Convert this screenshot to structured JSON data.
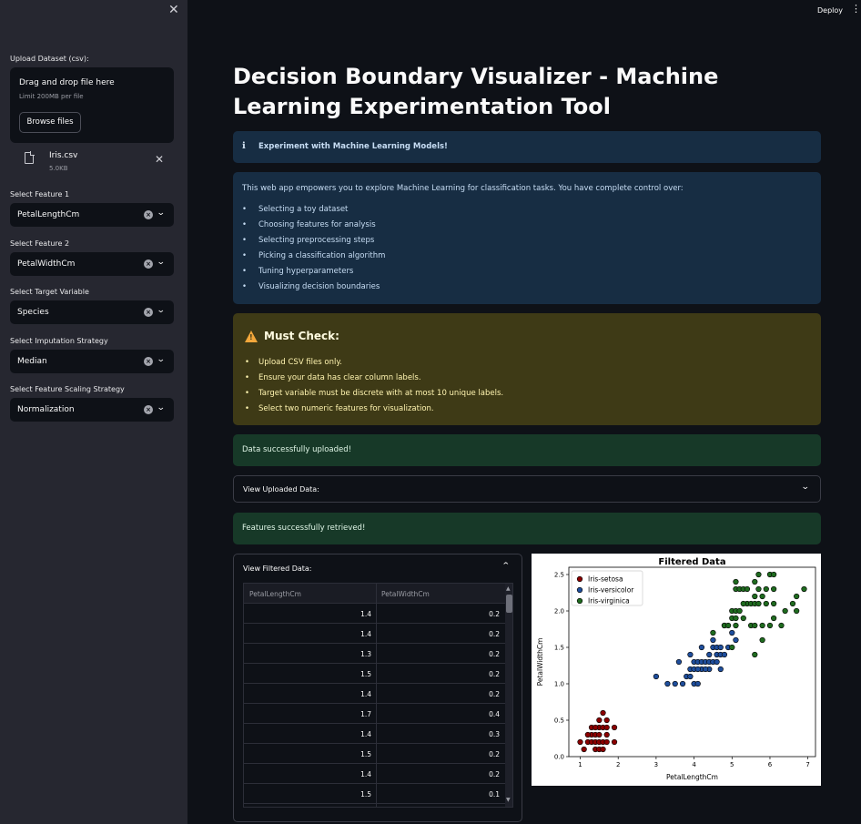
{
  "sidebar": {
    "close_label": "✕",
    "upload_label": "Upload Dataset (csv):",
    "dropzone_title": "Drag and drop file here",
    "dropzone_limit": "Limit 200MB per file",
    "browse_label": "Browse files",
    "file_name": "Iris.csv",
    "file_size": "5.0KB",
    "remove_label": "✕",
    "selects": [
      {
        "label": "Select Feature 1",
        "value": "PetalLengthCm"
      },
      {
        "label": "Select Feature 2",
        "value": "PetalWidthCm"
      },
      {
        "label": "Select Target Variable",
        "value": "Species"
      },
      {
        "label": "Select Imputation Strategy",
        "value": "Median"
      },
      {
        "label": "Select Feature Scaling Strategy",
        "value": "Normalization"
      }
    ]
  },
  "header": {
    "deploy_label": "Deploy",
    "menu_label": "⋮"
  },
  "main": {
    "title": "Decision Boundary Visualizer - Machine Learning Experimentation Tool",
    "info_title": "Experiment with Machine Learning Models!",
    "intro": "This web app empowers you to explore Machine Learning for classification tasks. You have complete control over:",
    "features": [
      "Selecting a toy dataset",
      "Choosing features for analysis",
      "Selecting preprocessing steps",
      "Picking a classification algorithm",
      "Tuning hyperparameters",
      "Visualizing decision boundaries"
    ],
    "warning_title": "Must Check:",
    "warnings": [
      "Upload CSV files only.",
      "Ensure your data has clear column labels.",
      "Target variable must be discrete with at most 10 unique labels.",
      "Select two numeric features for visualization."
    ],
    "success_upload": "Data successfully uploaded!",
    "expander_uploaded": "View Uploaded Data:",
    "success_features": "Features successfully retrieved!",
    "expander_filtered": "View Filtered Data:",
    "table": {
      "columns": [
        "PetalLengthCm",
        "PetalWidthCm"
      ],
      "rows": [
        [
          "1.4",
          "0.2"
        ],
        [
          "1.4",
          "0.2"
        ],
        [
          "1.3",
          "0.2"
        ],
        [
          "1.5",
          "0.2"
        ],
        [
          "1.4",
          "0.2"
        ],
        [
          "1.7",
          "0.4"
        ],
        [
          "1.4",
          "0.3"
        ],
        [
          "1.5",
          "0.2"
        ],
        [
          "1.4",
          "0.2"
        ],
        [
          "1.5",
          "0.1"
        ]
      ]
    }
  },
  "colors": {
    "setosa": "#8b0000",
    "versicolor": "#1f4e9c",
    "virginica": "#1f6b1f"
  },
  "chart_data": {
    "type": "scatter",
    "title": "Filtered Data",
    "xlabel": "PetalLengthCm",
    "ylabel": "PetalWidthCm",
    "xlim": [
      0.7,
      7.2
    ],
    "ylim": [
      0,
      2.6
    ],
    "xticks": [
      1,
      2,
      3,
      4,
      5,
      6,
      7
    ],
    "yticks": [
      0.0,
      0.5,
      1.0,
      1.5,
      2.0,
      2.5
    ],
    "legend_position": "top-left",
    "series": [
      {
        "name": "Iris-setosa",
        "color": "#8b0000",
        "points": [
          [
            1.0,
            0.2
          ],
          [
            1.1,
            0.1
          ],
          [
            1.2,
            0.2
          ],
          [
            1.3,
            0.2
          ],
          [
            1.3,
            0.3
          ],
          [
            1.3,
            0.4
          ],
          [
            1.4,
            0.1
          ],
          [
            1.4,
            0.2
          ],
          [
            1.4,
            0.3
          ],
          [
            1.5,
            0.1
          ],
          [
            1.5,
            0.2
          ],
          [
            1.5,
            0.3
          ],
          [
            1.5,
            0.4
          ],
          [
            1.6,
            0.2
          ],
          [
            1.6,
            0.4
          ],
          [
            1.6,
            0.6
          ],
          [
            1.7,
            0.2
          ],
          [
            1.7,
            0.3
          ],
          [
            1.7,
            0.4
          ],
          [
            1.7,
            0.5
          ],
          [
            1.9,
            0.2
          ],
          [
            1.9,
            0.4
          ],
          [
            1.6,
            0.1
          ],
          [
            1.2,
            0.3
          ],
          [
            1.4,
            0.4
          ],
          [
            1.5,
            0.5
          ]
        ]
      },
      {
        "name": "Iris-versicolor",
        "color": "#1f4e9c",
        "points": [
          [
            3.0,
            1.1
          ],
          [
            3.3,
            1.0
          ],
          [
            3.5,
            1.0
          ],
          [
            3.6,
            1.3
          ],
          [
            3.7,
            1.0
          ],
          [
            3.8,
            1.1
          ],
          [
            3.9,
            1.1
          ],
          [
            3.9,
            1.2
          ],
          [
            3.9,
            1.4
          ],
          [
            4.0,
            1.0
          ],
          [
            4.0,
            1.2
          ],
          [
            4.0,
            1.3
          ],
          [
            4.1,
            1.0
          ],
          [
            4.1,
            1.3
          ],
          [
            4.2,
            1.2
          ],
          [
            4.2,
            1.3
          ],
          [
            4.2,
            1.5
          ],
          [
            4.3,
            1.3
          ],
          [
            4.4,
            1.2
          ],
          [
            4.4,
            1.3
          ],
          [
            4.4,
            1.4
          ],
          [
            4.5,
            1.3
          ],
          [
            4.5,
            1.5
          ],
          [
            4.5,
            1.6
          ],
          [
            4.6,
            1.3
          ],
          [
            4.6,
            1.4
          ],
          [
            4.6,
            1.5
          ],
          [
            4.7,
            1.2
          ],
          [
            4.7,
            1.4
          ],
          [
            4.7,
            1.5
          ],
          [
            4.8,
            1.4
          ],
          [
            4.8,
            1.8
          ],
          [
            4.9,
            1.5
          ],
          [
            5.0,
            1.7
          ],
          [
            5.1,
            1.6
          ],
          [
            4.1,
            1.2
          ],
          [
            4.3,
            1.2
          ]
        ]
      },
      {
        "name": "Iris-virginica",
        "color": "#1f6b1f",
        "points": [
          [
            4.5,
            1.7
          ],
          [
            4.8,
            1.8
          ],
          [
            4.9,
            1.8
          ],
          [
            5.0,
            1.5
          ],
          [
            5.0,
            1.9
          ],
          [
            5.0,
            2.0
          ],
          [
            5.1,
            1.8
          ],
          [
            5.1,
            1.9
          ],
          [
            5.1,
            2.0
          ],
          [
            5.1,
            2.3
          ],
          [
            5.1,
            2.4
          ],
          [
            5.2,
            2.0
          ],
          [
            5.2,
            2.3
          ],
          [
            5.3,
            1.9
          ],
          [
            5.3,
            2.3
          ],
          [
            5.4,
            2.1
          ],
          [
            5.4,
            2.3
          ],
          [
            5.5,
            1.8
          ],
          [
            5.5,
            2.1
          ],
          [
            5.6,
            1.4
          ],
          [
            5.6,
            1.8
          ],
          [
            5.6,
            2.1
          ],
          [
            5.6,
            2.2
          ],
          [
            5.6,
            2.4
          ],
          [
            5.7,
            2.1
          ],
          [
            5.7,
            2.3
          ],
          [
            5.7,
            2.5
          ],
          [
            5.8,
            1.6
          ],
          [
            5.8,
            1.8
          ],
          [
            5.8,
            2.2
          ],
          [
            5.9,
            2.1
          ],
          [
            5.9,
            2.3
          ],
          [
            6.0,
            1.8
          ],
          [
            6.0,
            2.5
          ],
          [
            6.1,
            1.9
          ],
          [
            6.1,
            2.3
          ],
          [
            6.1,
            2.5
          ],
          [
            6.3,
            1.8
          ],
          [
            6.4,
            2.0
          ],
          [
            6.6,
            2.1
          ],
          [
            6.7,
            2.0
          ],
          [
            6.7,
            2.2
          ],
          [
            6.9,
            2.3
          ],
          [
            6.1,
            2.1
          ],
          [
            5.3,
            2.1
          ]
        ]
      }
    ]
  }
}
